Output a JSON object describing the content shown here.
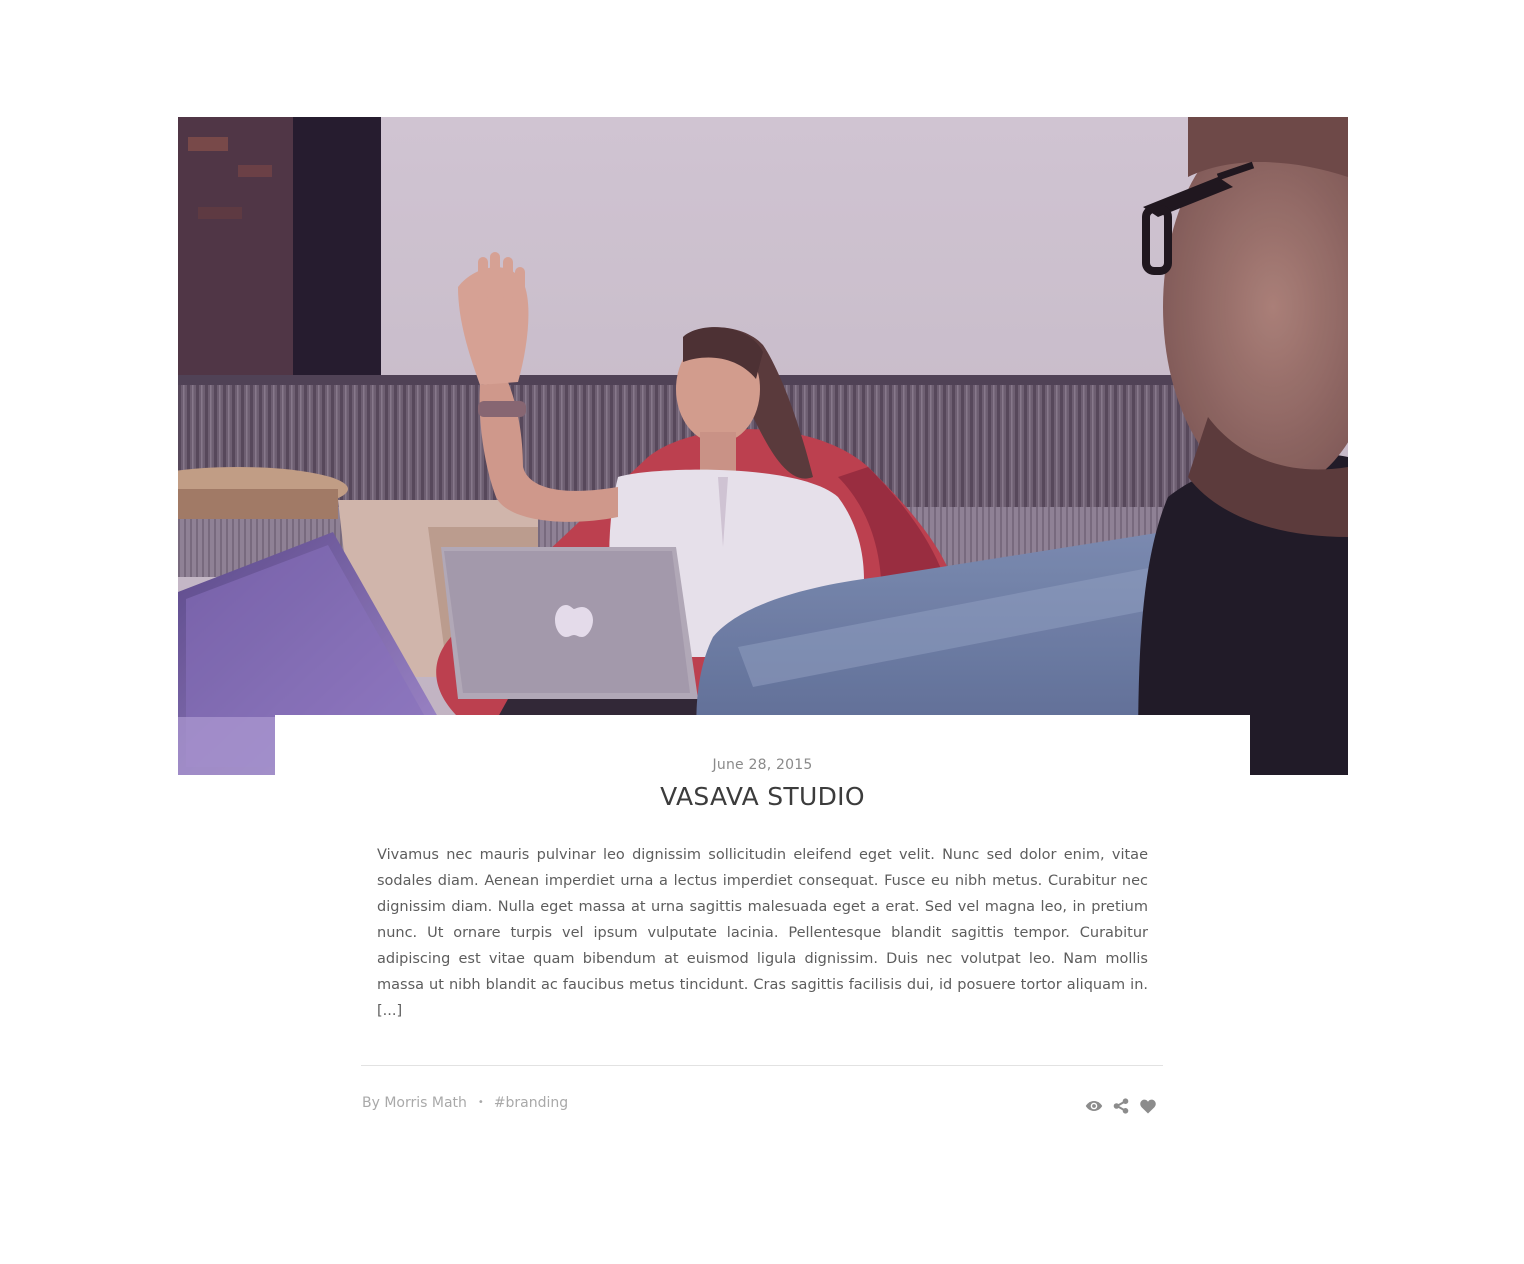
{
  "post": {
    "image_alt": "Woman with a laptop raising her hand in a meeting",
    "date": "June 28, 2015",
    "title": "VASAVA STUDIO",
    "excerpt": "Vivamus nec mauris pulvinar leo dignissim sollicitudin eleifend eget velit. Nunc sed dolor enim, vitae sodales diam. Aenean imperdiet urna a lectus imperdiet consequat. Fusce eu nibh metus. Curabitur nec dignissim diam. Nulla eget massa at urna sagittis malesuada eget a erat. Sed vel magna leo, in pretium nunc. Ut ornare turpis vel ipsum vulputate lacinia. Pellentesque blandit sagittis tempor. Curabitur adipiscing est vitae quam bibendum at euismod ligula dignissim. Duis nec volutpat leo. Nam mollis massa ut nibh blandit ac faucibus metus tincidunt. Cras sagittis facilisis dui, id posuere tortor aliquam in.",
    "read_more": "[...]",
    "author": "By Morris Math",
    "separator": "•",
    "tag": "#branding",
    "actions": [
      {
        "icon": "eye-icon",
        "label": "views"
      },
      {
        "icon": "share-icon",
        "label": "share"
      },
      {
        "icon": "heart-icon",
        "label": "like"
      }
    ]
  },
  "colors": {
    "title": "#3c3c3c",
    "body_text": "#5d5d5d",
    "meta_text": "#a9a9a9",
    "icon": "#8c8c8c",
    "divider": "#e2e2e2"
  }
}
